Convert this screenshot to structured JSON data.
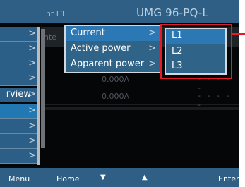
{
  "header": {
    "title_fragment": "nt L1",
    "model": "UMG 96-PQ-L"
  },
  "background": {
    "column_header_fragment": "nte",
    "rows": [
      {
        "value": "0.000A",
        "dashes": "- - - - -"
      },
      {
        "value": "0.000A",
        "dashes": "- - - - -"
      }
    ]
  },
  "sidebar": {
    "items": [
      {
        "label": "",
        "chevron": ">"
      },
      {
        "label": "",
        "chevron": ">"
      },
      {
        "label": "",
        "chevron": ">"
      },
      {
        "label": "",
        "chevron": ">"
      },
      {
        "label": "rview",
        "chevron": ">"
      },
      {
        "label": "",
        "chevron": ">"
      },
      {
        "label": "",
        "chevron": ">"
      },
      {
        "label": "",
        "chevron": ">"
      },
      {
        "label": "",
        "chevron": ">"
      }
    ],
    "selected_index": 5
  },
  "submenu": {
    "items": [
      {
        "label": "Current",
        "chevron": ">"
      },
      {
        "label": "Active power",
        "chevron": ">"
      },
      {
        "label": "Apparent power",
        "chevron": ">"
      }
    ],
    "selected_index": 0
  },
  "phase_menu": {
    "items": [
      {
        "label": "L1"
      },
      {
        "label": "L2"
      },
      {
        "label": "L3"
      }
    ],
    "selected_index": 0
  },
  "footer": {
    "menu": "Menu",
    "home": "Home",
    "down_icon": "▼",
    "up_icon": "▲",
    "enter": "Enter"
  },
  "colors": {
    "accent_blue": "#2f5f84",
    "selected_blue": "#2b78b5",
    "highlight_red": "#e31c25"
  }
}
